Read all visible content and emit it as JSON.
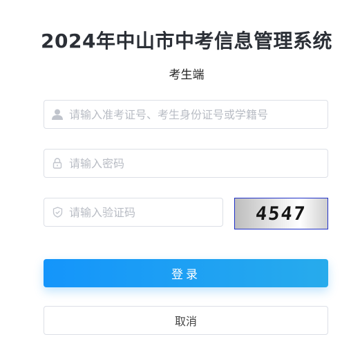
{
  "header": {
    "title": "2024年中山市中考信息管理系统",
    "subtitle": "考生端"
  },
  "form": {
    "username": {
      "placeholder": "请输入准考证号、考生身份证号或学籍号",
      "value": "",
      "icon": "user-icon"
    },
    "password": {
      "placeholder": "请输入密码",
      "value": "",
      "icon": "lock-icon"
    },
    "captcha": {
      "placeholder": "请输入验证码",
      "value": "",
      "icon": "shield-icon"
    },
    "captcha_image_text": "4547"
  },
  "buttons": {
    "login_label": "登录",
    "cancel_label": "取消"
  },
  "colors": {
    "primary_start": "#1495fb",
    "primary_end": "#27abec",
    "border": "#dcdfe6",
    "placeholder": "#b8bcc4",
    "captcha_border": "#1e2fc8"
  }
}
